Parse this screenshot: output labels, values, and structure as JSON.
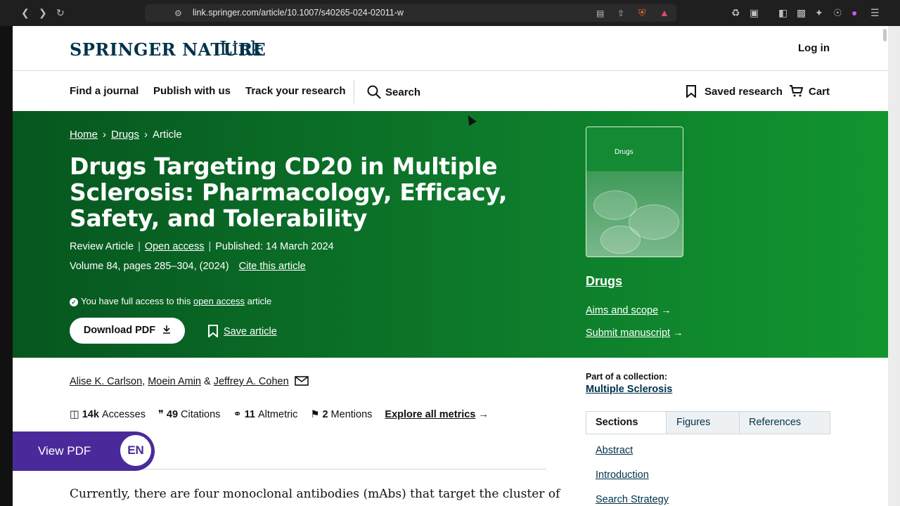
{
  "browser": {
    "url": "link.springer.com/article/10.1007/s40265-024-02011-w"
  },
  "header": {
    "logo_primary": "SPRINGER NATURE",
    "logo_secondary": "Link",
    "login": "Log in"
  },
  "nav": {
    "items": [
      "Find a journal",
      "Publish with us",
      "Track your research"
    ],
    "search": "Search",
    "saved": "Saved research",
    "cart": "Cart"
  },
  "breadcrumb": {
    "home": "Home",
    "drugs": "Drugs",
    "article": "Article"
  },
  "article": {
    "title": "Drugs Targeting CD20 in Multiple Sclerosis: Pharmacology, Efficacy, Safety, and Tolerability",
    "type": "Review Article",
    "open_access": "Open access",
    "published": "Published: 14 March 2024",
    "volume": "Volume 84, pages 285–304, (2024)",
    "cite": "Cite this article",
    "access_prefix": "You have full access to this",
    "access_link": "open access",
    "access_suffix": "article",
    "download": "Download PDF",
    "save": "Save article"
  },
  "journal": {
    "cover_title": "Drugs",
    "name": "Drugs",
    "aims": "Aims and scope",
    "submit": "Submit manuscript"
  },
  "authors": [
    "Alise K. Carlson",
    "Moein Amin",
    "Jeffrey A. Cohen"
  ],
  "metrics": {
    "accesses_value": "14k",
    "accesses_label": "Accesses",
    "citations_value": "49",
    "citations_label": "Citations",
    "altmetric_value": "11",
    "altmetric_label": "Altmetric",
    "mentions_value": "2",
    "mentions_label": "Mentions",
    "explore": "Explore all metrics"
  },
  "collection": {
    "label": "Part of a collection:",
    "name": "Multiple Sclerosis"
  },
  "sidebar_tabs": [
    "Sections",
    "Figures",
    "References"
  ],
  "toc": [
    "Abstract",
    "Introduction",
    "Search Strategy"
  ],
  "body_text": "Currently, there are four monoclonal antibodies (mAbs) that target the cluster of",
  "floating": {
    "view_pdf": "View PDF",
    "lang": "EN"
  }
}
